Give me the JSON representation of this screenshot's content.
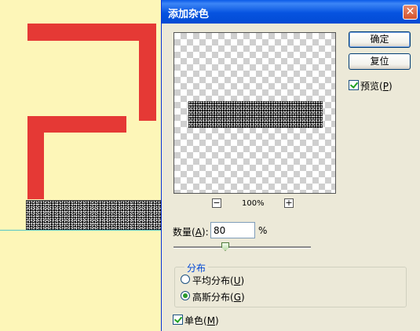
{
  "dialog": {
    "title": "添加杂色",
    "close_glyph": "✕",
    "ok_label": "确定",
    "reset_label": "复位",
    "preview_checkbox": {
      "label_prefix": "预览(",
      "hotkey": "P",
      "label_suffix": ")",
      "checked": true
    },
    "zoom": {
      "minus": "−",
      "plus": "+",
      "level": "100%"
    },
    "amount": {
      "label_prefix": "数量(",
      "hotkey": "A",
      "label_suffix": "):",
      "value": "80",
      "unit": "%",
      "slider_fraction": 0.4
    },
    "distribution": {
      "legend": "分布",
      "options": [
        {
          "label_prefix": "平均分布(",
          "hotkey": "U",
          "label_suffix": ")",
          "selected": false
        },
        {
          "label_prefix": "高斯分布(",
          "hotkey": "G",
          "label_suffix": ")",
          "selected": true
        }
      ]
    },
    "monochromatic_checkbox": {
      "label_prefix": "单色(",
      "hotkey": "M",
      "label_suffix": ")",
      "checked": true
    }
  },
  "colors": {
    "canvas_bg": "#fdf6b8",
    "shape_red": "#e53935",
    "titlebar_blue": "#0653e0",
    "guide_cyan": "#55c6c6"
  }
}
